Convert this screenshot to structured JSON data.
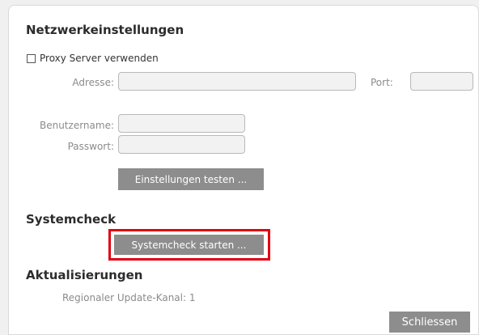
{
  "network": {
    "title": "Netzwerkeinstellungen",
    "proxy_label": "Proxy Server verwenden",
    "proxy_checked": false,
    "address_label": "Adresse:",
    "address_value": "",
    "port_label": "Port:",
    "port_value": "",
    "username_label": "Benutzername:",
    "username_value": "",
    "password_label": "Passwort:",
    "password_value": "",
    "test_button": "Einstellungen testen ..."
  },
  "systemcheck": {
    "title": "Systemcheck",
    "start_button": "Systemcheck starten ..."
  },
  "updates": {
    "title": "Aktualisierungen",
    "channel_text": "Regionaler Update-Kanal: 1"
  },
  "footer": {
    "close_button": "Schliessen"
  },
  "colors": {
    "button_bg": "#8d8d8d",
    "highlight": "#e3000f"
  }
}
